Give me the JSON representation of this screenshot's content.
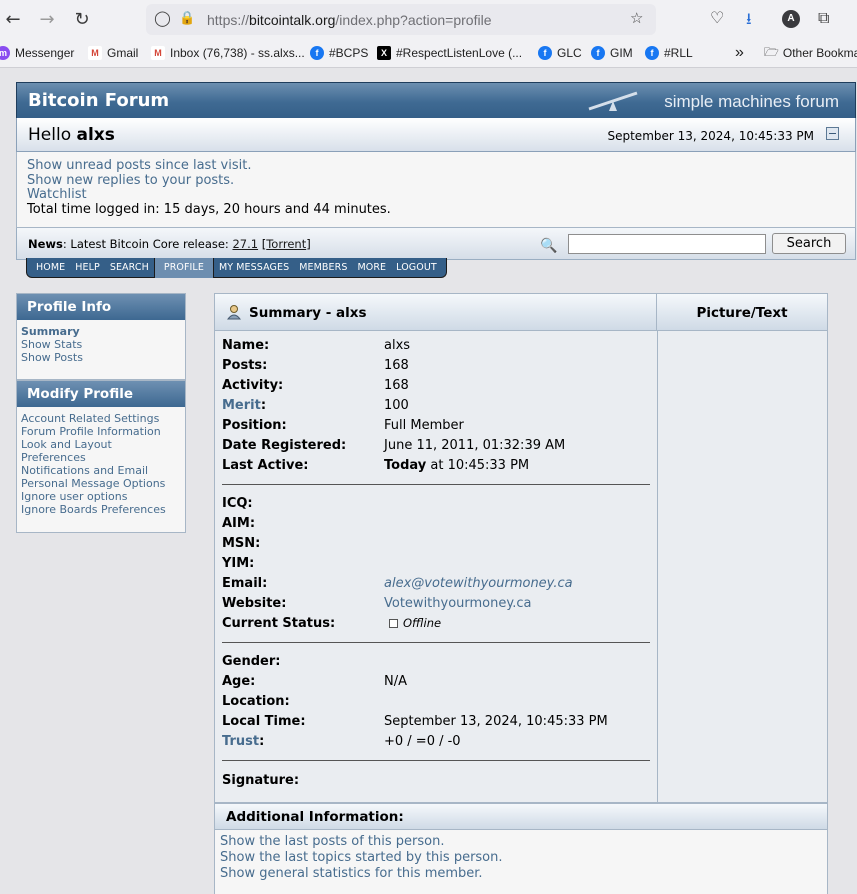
{
  "browser": {
    "url_prefix": "https://",
    "url_host": "bitcointalk.org",
    "url_path": "/index.php?action=profile",
    "profile_initial": "A",
    "bookmarks": [
      {
        "label": "Messenger",
        "icon": "messenger-icon"
      },
      {
        "label": "Gmail",
        "icon": "gmail-icon"
      },
      {
        "label": "Inbox (76,738) - ss.alxs...",
        "icon": "gmail-icon"
      },
      {
        "label": "#BCPS",
        "icon": "facebook-icon"
      },
      {
        "label": "#RespectListenLove (...",
        "icon": "x-icon"
      },
      {
        "label": "GLC",
        "icon": "facebook-icon"
      },
      {
        "label": "GIM",
        "icon": "facebook-icon"
      },
      {
        "label": "#RLL",
        "icon": "facebook-icon"
      }
    ],
    "other_bookmarks": "Other Bookma"
  },
  "header": {
    "forum_name": "Bitcoin Forum",
    "smf_logo": "simple machines forum",
    "hello_prefix": "Hello",
    "username": "alxs",
    "datetime": "September 13, 2024, 10:45:33 PM"
  },
  "user_links": {
    "unread": "Show unread posts since last visit.",
    "replies": "Show new replies to your posts.",
    "watchlist": "Watchlist",
    "time_logged": "Total time logged in: 15 days, 20 hours and 44 minutes."
  },
  "news": {
    "label": "News",
    "text": ": Latest Bitcoin Core release: ",
    "version": "27.1",
    "torrent": "Torrent",
    "search_button": "Search"
  },
  "menu": [
    "HOME",
    "HELP",
    "SEARCH",
    "PROFILE",
    "MY MESSAGES",
    "MEMBERS",
    "MORE",
    "LOGOUT"
  ],
  "profile_info": {
    "title": "Profile Info",
    "links": [
      "Summary",
      "Show Stats",
      "Show Posts"
    ]
  },
  "modify_profile": {
    "title": "Modify Profile",
    "links": [
      "Account Related Settings",
      "Forum Profile Information",
      "Look and Layout",
      "Preferences",
      "Notifications and Email",
      "Personal Message Options",
      "Ignore user options",
      "Ignore Boards Preferences"
    ]
  },
  "summary": {
    "title": "Summary - alxs",
    "picture_title": "Picture/Text",
    "name_label": "Name:",
    "name": "alxs",
    "posts_label": "Posts:",
    "posts": "168",
    "activity_label": "Activity:",
    "activity": "168",
    "merit_label": "Merit",
    "merit_colon": ":",
    "merit": "100",
    "position_label": "Position:",
    "position": "Full Member",
    "registered_label": "Date Registered:",
    "registered": "June 11, 2011, 01:32:39 AM",
    "last_active_label": "Last Active:",
    "last_active_today": "Today",
    "last_active_time": " at 10:45:33 PM",
    "icq_label": "ICQ:",
    "aim_label": "AIM:",
    "msn_label": "MSN:",
    "yim_label": "YIM:",
    "email_label": "Email:",
    "email": "alex@votewithyourmoney.ca",
    "website_label": "Website:",
    "website": "Votewithyourmoney.ca",
    "status_label": "Current Status:",
    "status": "Offline",
    "gender_label": "Gender:",
    "age_label": "Age:",
    "age": "N/A",
    "location_label": "Location:",
    "local_time_label": "Local Time:",
    "local_time": "September 13, 2024, 10:45:33 PM",
    "trust_label": "Trust",
    "trust_colon": ":",
    "trust": "+0 / =0 / -0",
    "signature_label": "Signature:"
  },
  "additional": {
    "title": "Additional Information:",
    "links": [
      "Show the last posts of this person.",
      "Show the last topics started by this person.",
      "Show general statistics for this member."
    ]
  }
}
